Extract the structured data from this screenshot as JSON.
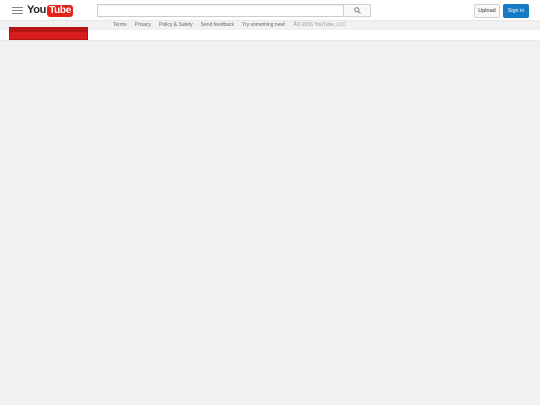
{
  "masthead": {
    "logo": {
      "you": "You",
      "tube": "Tube"
    },
    "search": {
      "placeholder": ""
    },
    "upload_label": "Upload",
    "signin_label": "Sign in"
  },
  "footer": {
    "links": [
      "Terms",
      "Privacy",
      "Policy & Safety",
      "Send feedback",
      "Try something new!"
    ],
    "copyright": "Â© 2016 YouTube, LLC"
  },
  "colors": {
    "brand_red": "#e62117",
    "signin_blue": "#167ac6",
    "page_bg": "#f1f1f1"
  },
  "icons": {
    "guide": "hamburger-menu-icon",
    "search": "magnifier-icon"
  }
}
